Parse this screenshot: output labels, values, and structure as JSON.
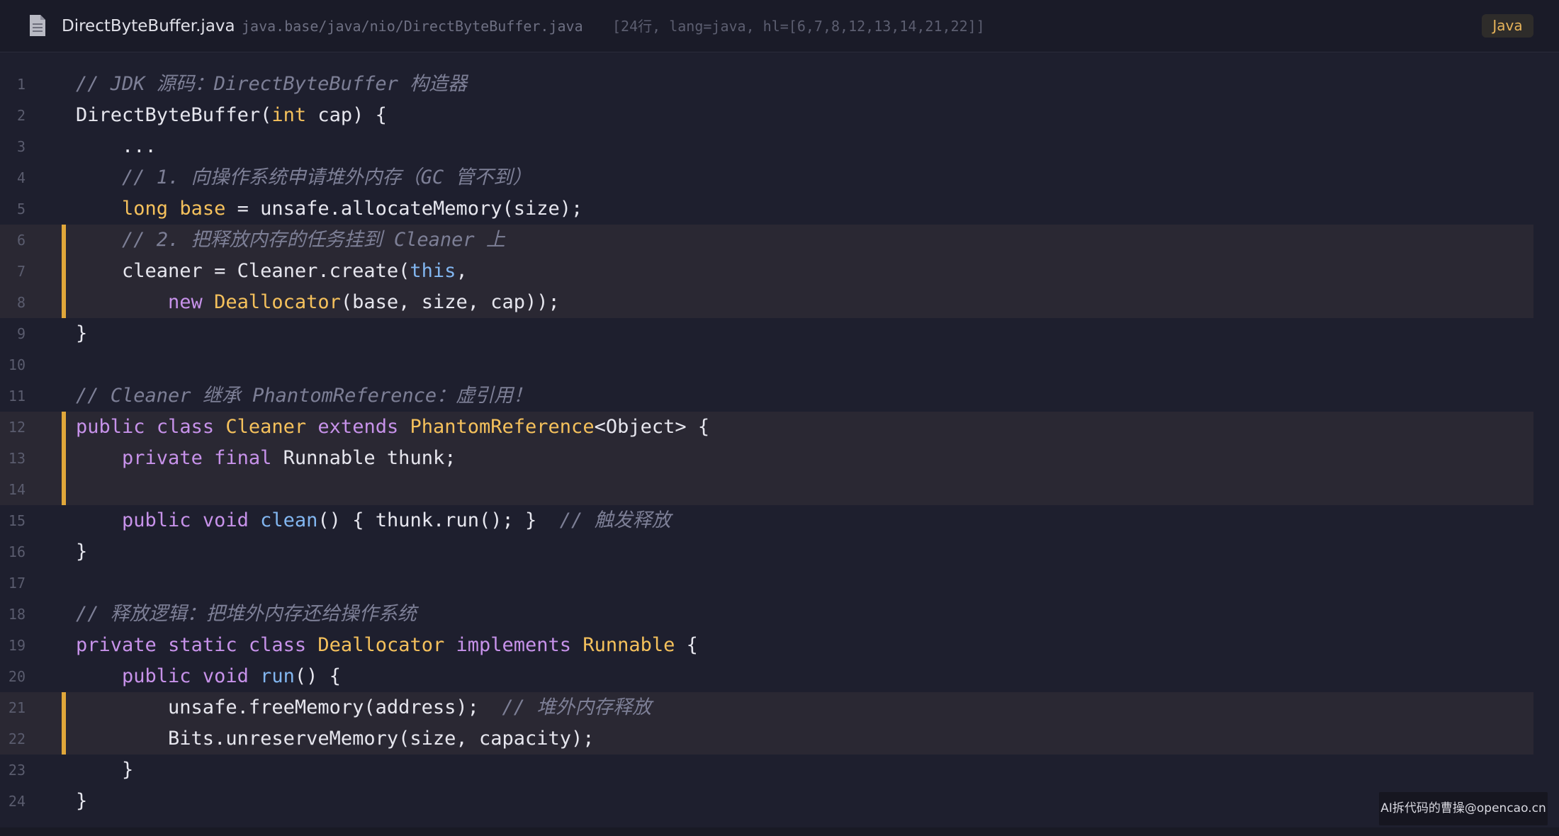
{
  "header": {
    "filename": "DirectByteBuffer.java",
    "path": "java.base/java/nio/DirectByteBuffer.java",
    "meta": "[24行, lang=java, hl=[6,7,8,12,13,14,21,22]]",
    "lang_badge": "Java",
    "file_icon": "file-document-icon"
  },
  "colors": {
    "background": "#1e1f2e",
    "highlight_bar": "#e0a73a",
    "comment": "#7d7f96",
    "keyword": "#c792ea",
    "type": "#f5c15c",
    "function": "#82b6f0",
    "text": "#e6e6ee"
  },
  "highlighted_lines": [
    6,
    7,
    8,
    12,
    13,
    14,
    21,
    22
  ],
  "code": {
    "lines": [
      {
        "n": "1",
        "tokens": [
          [
            "comment",
            "// JDK 源码：DirectByteBuffer 构造器"
          ]
        ]
      },
      {
        "n": "2",
        "tokens": [
          [
            "plain",
            "DirectByteBuffer("
          ],
          [
            "type",
            "int"
          ],
          [
            "plain",
            " cap) {"
          ]
        ]
      },
      {
        "n": "3",
        "tokens": [
          [
            "plain",
            "    ..."
          ]
        ]
      },
      {
        "n": "4",
        "tokens": [
          [
            "plain",
            "    "
          ],
          [
            "comment",
            "// 1. 向操作系统申请堆外内存（GC 管不到）"
          ]
        ]
      },
      {
        "n": "5",
        "tokens": [
          [
            "plain",
            "    "
          ],
          [
            "type",
            "long"
          ],
          [
            "plain",
            " "
          ],
          [
            "type",
            "base"
          ],
          [
            "plain",
            " = unsafe.allocateMemory(size);"
          ]
        ]
      },
      {
        "n": "6",
        "tokens": [
          [
            "plain",
            "    "
          ],
          [
            "comment",
            "// 2. 把释放内存的任务挂到 Cleaner 上"
          ]
        ]
      },
      {
        "n": "7",
        "tokens": [
          [
            "plain",
            "    cleaner = Cleaner.create("
          ],
          [
            "this",
            "this"
          ],
          [
            "plain",
            ","
          ]
        ]
      },
      {
        "n": "8",
        "tokens": [
          [
            "plain",
            "        "
          ],
          [
            "kw",
            "new"
          ],
          [
            "plain",
            " "
          ],
          [
            "type",
            "Deallocator"
          ],
          [
            "plain",
            "(base, size, cap));"
          ]
        ]
      },
      {
        "n": "9",
        "tokens": [
          [
            "plain",
            "}"
          ]
        ]
      },
      {
        "n": "10",
        "tokens": []
      },
      {
        "n": "11",
        "tokens": [
          [
            "comment",
            "// Cleaner 继承 PhantomReference：虚引用！"
          ]
        ]
      },
      {
        "n": "12",
        "tokens": [
          [
            "kw",
            "public"
          ],
          [
            "plain",
            " "
          ],
          [
            "kw",
            "class"
          ],
          [
            "plain",
            " "
          ],
          [
            "type",
            "Cleaner"
          ],
          [
            "plain",
            " "
          ],
          [
            "kw",
            "extends"
          ],
          [
            "plain",
            " "
          ],
          [
            "type",
            "PhantomReference"
          ],
          [
            "plain",
            "<Object> {"
          ]
        ]
      },
      {
        "n": "13",
        "tokens": [
          [
            "plain",
            "    "
          ],
          [
            "kw",
            "private"
          ],
          [
            "plain",
            " "
          ],
          [
            "kw",
            "final"
          ],
          [
            "plain",
            " Runnable thunk;"
          ]
        ]
      },
      {
        "n": "14",
        "tokens": []
      },
      {
        "n": "15",
        "tokens": [
          [
            "plain",
            "    "
          ],
          [
            "kw",
            "public"
          ],
          [
            "plain",
            " "
          ],
          [
            "kw",
            "void"
          ],
          [
            "plain",
            " "
          ],
          [
            "fn",
            "clean"
          ],
          [
            "plain",
            "() { thunk.run(); }  "
          ],
          [
            "comment",
            "// 触发释放"
          ]
        ]
      },
      {
        "n": "16",
        "tokens": [
          [
            "plain",
            "}"
          ]
        ]
      },
      {
        "n": "17",
        "tokens": []
      },
      {
        "n": "18",
        "tokens": [
          [
            "comment",
            "// 释放逻辑：把堆外内存还给操作系统"
          ]
        ]
      },
      {
        "n": "19",
        "tokens": [
          [
            "kw",
            "private"
          ],
          [
            "plain",
            " "
          ],
          [
            "kw",
            "static"
          ],
          [
            "plain",
            " "
          ],
          [
            "kw",
            "class"
          ],
          [
            "plain",
            " "
          ],
          [
            "type",
            "Deallocator"
          ],
          [
            "plain",
            " "
          ],
          [
            "kw",
            "implements"
          ],
          [
            "plain",
            " "
          ],
          [
            "type",
            "Runnable"
          ],
          [
            "plain",
            " {"
          ]
        ]
      },
      {
        "n": "20",
        "tokens": [
          [
            "plain",
            "    "
          ],
          [
            "kw",
            "public"
          ],
          [
            "plain",
            " "
          ],
          [
            "kw",
            "void"
          ],
          [
            "plain",
            " "
          ],
          [
            "fn",
            "run"
          ],
          [
            "plain",
            "() {"
          ]
        ]
      },
      {
        "n": "21",
        "tokens": [
          [
            "plain",
            "        unsafe.freeMemory(address);  "
          ],
          [
            "comment",
            "// 堆外内存释放"
          ]
        ]
      },
      {
        "n": "22",
        "tokens": [
          [
            "plain",
            "        Bits.unreserveMemory(size, capacity);"
          ]
        ]
      },
      {
        "n": "23",
        "tokens": [
          [
            "plain",
            "    }"
          ]
        ]
      },
      {
        "n": "24",
        "tokens": [
          [
            "plain",
            "}"
          ]
        ]
      }
    ]
  },
  "watermark": "AI拆代码的曹操@opencao.cn"
}
